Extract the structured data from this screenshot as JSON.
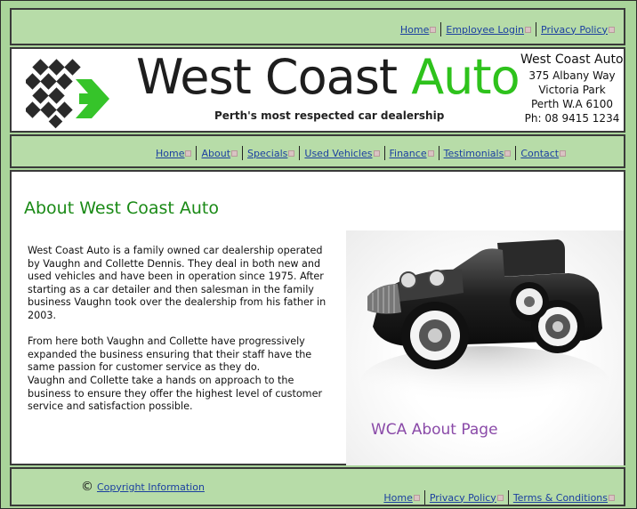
{
  "top_links": [
    {
      "label": "Home"
    },
    {
      "label": "Employee Login"
    },
    {
      "label": "Privacy Policy"
    }
  ],
  "header": {
    "brand_prefix": "West Coast ",
    "brand_suffix": "Auto",
    "tagline": "Perth's most respected car dealership",
    "company": "West Coast Auto",
    "address_lines": [
      "375 Albany Way",
      "Victoria Park",
      "Perth  W.A 6100",
      "Ph: 08 9415 1234"
    ]
  },
  "nav": [
    {
      "label": "Home"
    },
    {
      "label": "About"
    },
    {
      "label": "Specials"
    },
    {
      "label": "Used Vehicles"
    },
    {
      "label": "Finance"
    },
    {
      "label": "Testimonials"
    },
    {
      "label": "Contact"
    }
  ],
  "main": {
    "heading": "About West Coast Auto",
    "paragraphs": [
      "West Coast Auto is a family owned car dealership operated by Vaughn and Collette Dennis. They deal in both new and used vehicles and have been in operation since 1975. After starting as a car detailer and then salesman in the family business Vaughn took over the dealership from his father in 2003.",
      "From here both Vaughn and Collette have progressively expanded the business ensuring that their staff have the same passion for customer service as they do.",
      "Vaughn and Collette take a hands on approach to the business to ensure they offer the highest level of customer service and satisfaction possible."
    ],
    "caption": "WCA About Page"
  },
  "footer": {
    "copyright_symbol": "©",
    "copyright_link": "Copyright Information",
    "links": [
      {
        "label": "Home"
      },
      {
        "label": "Privacy Policy"
      },
      {
        "label": "Terms & Conditions"
      }
    ]
  },
  "colors": {
    "band": "#b7dca8",
    "outer": "#a9d49a",
    "heading": "#1a8a16",
    "brand_green": "#2ec21c",
    "link": "#1b3fa0",
    "caption": "#8a4aa8"
  }
}
